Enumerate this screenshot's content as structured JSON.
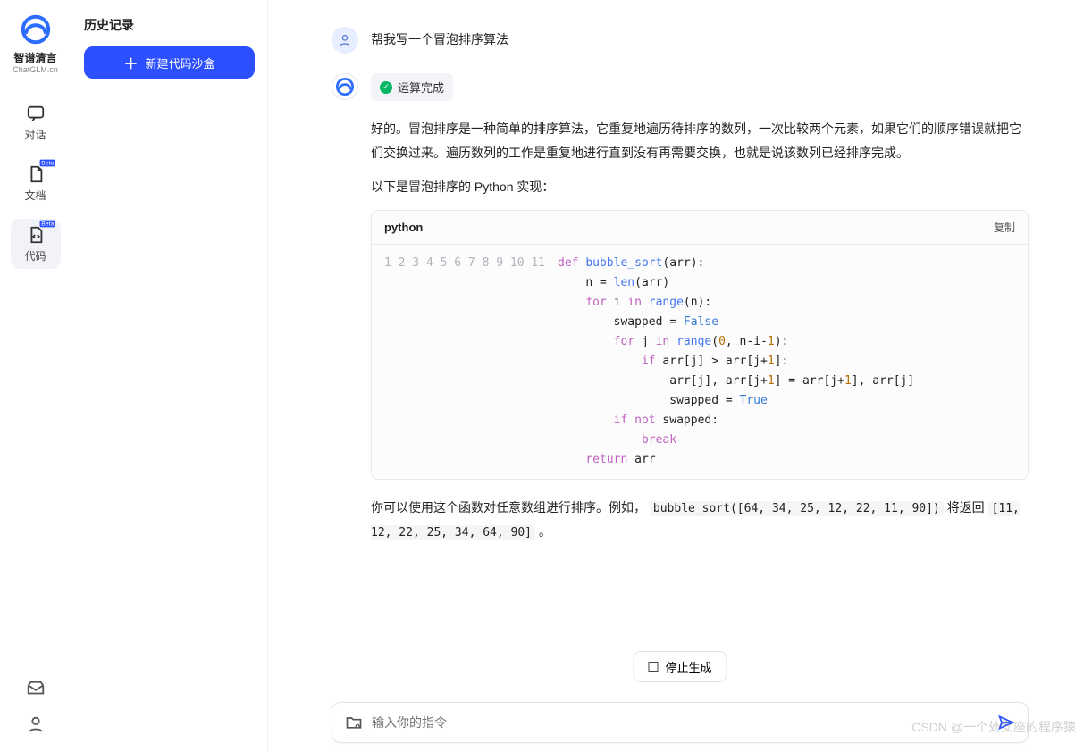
{
  "brand": {
    "name": "智谱清言",
    "sub": "ChatGLM.cn"
  },
  "nav": {
    "chat": "对话",
    "doc": "文档",
    "code": "代码",
    "beta": "Beta"
  },
  "sidebar": {
    "history_title": "历史记录",
    "new_btn": "新建代码沙盒"
  },
  "chat": {
    "user_msg": "帮我写一个冒泡排序算法",
    "status": "运算完成",
    "para1": "好的。冒泡排序是一种简单的排序算法，它重复地遍历待排序的数列，一次比较两个元素，如果它们的顺序错误就把它们交换过来。遍历数列的工作是重复地进行直到没有再需要交换，也就是说该数列已经排序完成。",
    "para2": "以下是冒泡排序的 Python 实现：",
    "code": {
      "lang": "python",
      "copy": "复制",
      "lines": [
        "def bubble_sort(arr):",
        "    n = len(arr)",
        "    for i in range(n):",
        "        swapped = False",
        "        for j in range(0, n-i-1):",
        "            if arr[j] > arr[j+1]:",
        "                arr[j], arr[j+1] = arr[j+1], arr[j]",
        "                swapped = True",
        "        if not swapped:",
        "            break",
        "    return arr"
      ]
    },
    "para3_pre": "你可以使用这个函数对任意数组进行排序。例如， ",
    "para3_code1": "bubble_sort([64, 34, 25, 12, 22, 11, 90])",
    "para3_mid": " 将返回 ",
    "para3_code2": "[11, 12, 22, 25, 34, 64, 90]",
    "para3_post": " 。"
  },
  "controls": {
    "stop": "停止生成",
    "placeholder": "输入你的指令"
  },
  "watermark": "CSDN @一个处女座的程序猿"
}
